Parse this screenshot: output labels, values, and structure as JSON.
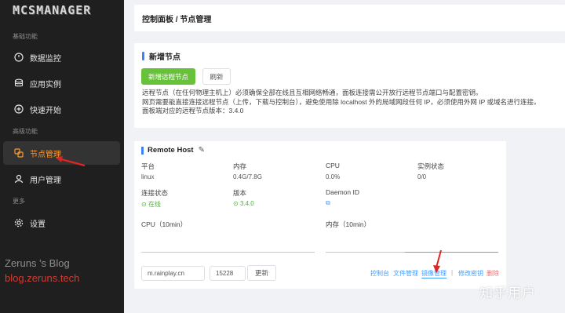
{
  "sidebar": {
    "logo": "MCSMANAGER",
    "sections": {
      "basic": "基础功能",
      "advanced": "高级功能",
      "more": "更多"
    },
    "items": [
      {
        "label": "数据监控",
        "icon": "dashboard-icon"
      },
      {
        "label": "应用实例",
        "icon": "database-icon"
      },
      {
        "label": "快速开始",
        "icon": "plus-circle-icon"
      },
      {
        "label": "节点管理",
        "icon": "nodes-icon",
        "active": true
      },
      {
        "label": "用户管理",
        "icon": "user-icon"
      },
      {
        "label": "设置",
        "icon": "gear-icon"
      }
    ],
    "active_color": "#ff9a2e"
  },
  "watermarks": {
    "blog_name": "Zeruns 's Blog",
    "blog_url": "blog.zeruns.tech",
    "zhihu": "知乎用户"
  },
  "header": {
    "breadcrumb": "控制面板 / 节点管理"
  },
  "add_node": {
    "title": "新增节点",
    "add_button": "新增远程节点",
    "refresh_button": "刷新",
    "desc_lines": [
      "远程节点（在任何物理主机上）必须确保全部在线且互相网络畅通，面板连接需公开放行远程节点端口与配置密钥。",
      "网页需要能直接连接远程节点（上传，下载与控制台），避免使用除 localhost 外的局域网段任何 IP，必须使用外网 IP 或域名进行连接。",
      "面板端对应的远程节点版本：3.4.0"
    ]
  },
  "host": {
    "title": "Remote Host",
    "fields": {
      "platform_label": "平台",
      "platform_value": "linux",
      "memory_label": "内存",
      "memory_value": "0.4G/7.8G",
      "cpu_label": "CPU",
      "cpu_value": "0.0%",
      "instance_label": "实例状态",
      "instance_value": "0/0",
      "conn_label": "连接状态",
      "conn_value": "在线",
      "version_label": "版本",
      "version_value": "3.4.0",
      "daemon_label": "Daemon ID"
    },
    "cpu_chart_label": "CPU（10min）",
    "mem_chart_label": "内存（10min）",
    "address": "m.rainplay.cn",
    "port": "15228",
    "update_button": "更新",
    "links": {
      "console": "控制台",
      "files": "文件管理",
      "images": "镜像管理",
      "change_key": "修改密钥",
      "delete": "删除"
    }
  }
}
